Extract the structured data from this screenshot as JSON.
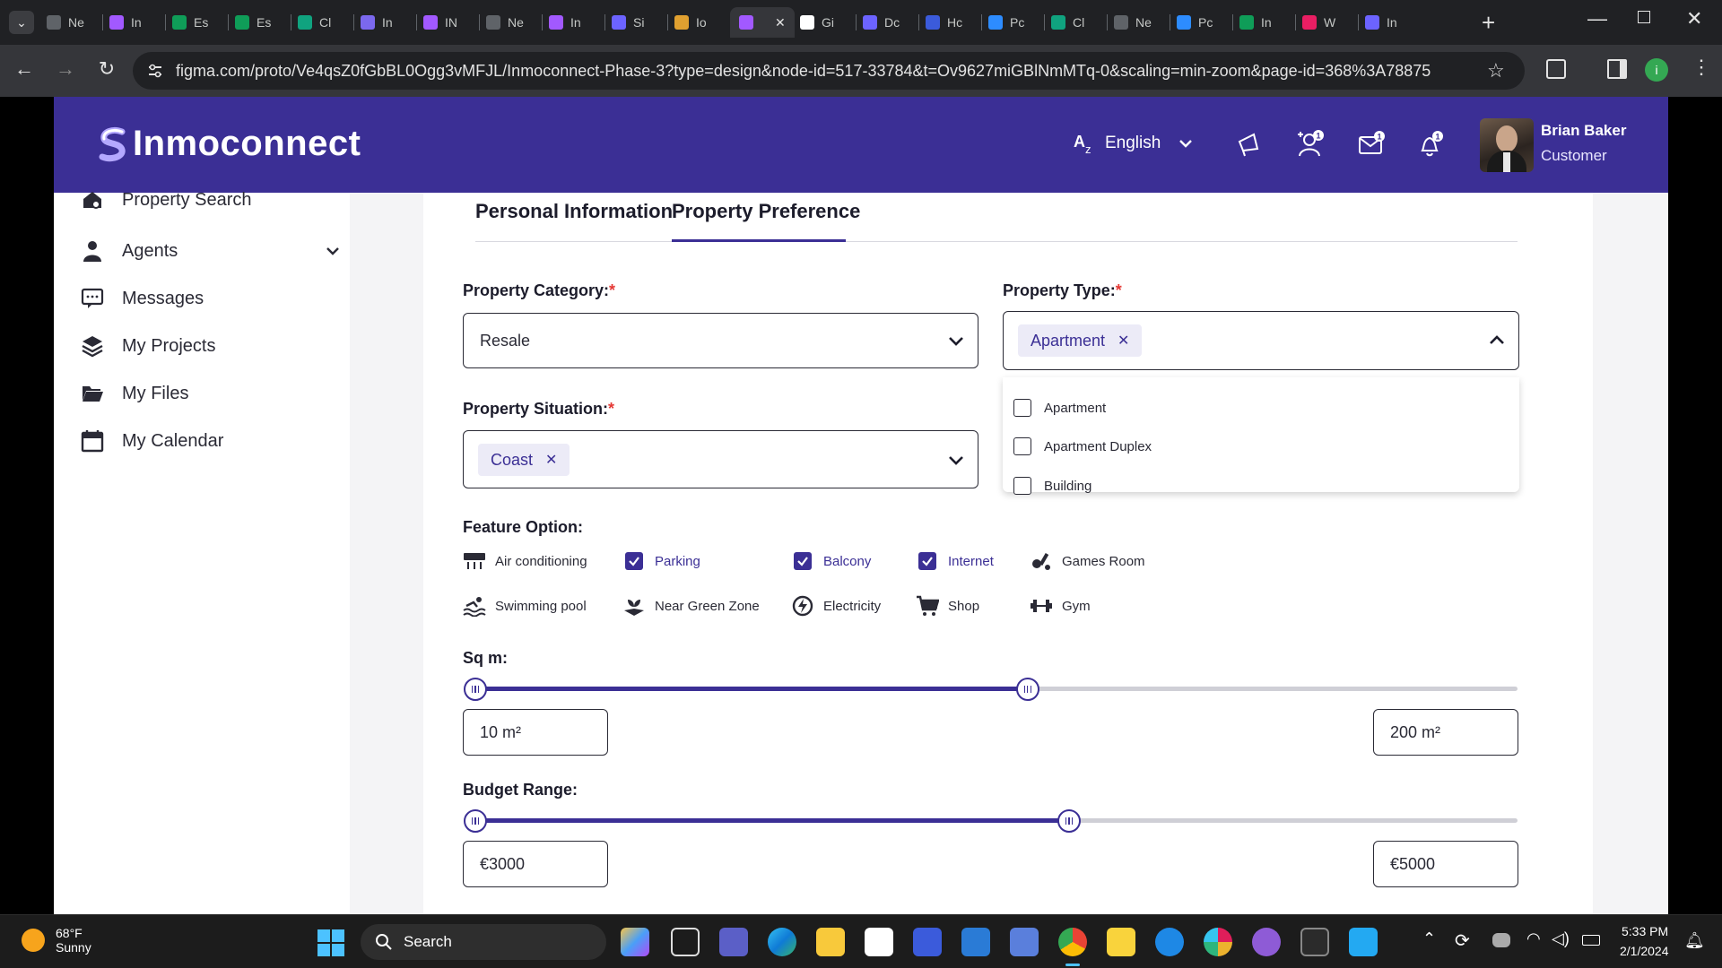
{
  "browser": {
    "tabs": [
      {
        "label": "Ne",
        "color": "#5f6368"
      },
      {
        "label": "In",
        "color": "#a259ff"
      },
      {
        "label": "Es",
        "color": "#0f9d58"
      },
      {
        "label": "Es",
        "color": "#0f9d58"
      },
      {
        "label": "Cl",
        "color": "#10a37f"
      },
      {
        "label": "In",
        "color": "#7b68ee"
      },
      {
        "label": "IN",
        "color": "#a259ff"
      },
      {
        "label": "Ne",
        "color": "#5f6368"
      },
      {
        "label": "In",
        "color": "#a259ff"
      },
      {
        "label": "Si",
        "color": "#6c63ff"
      },
      {
        "label": "Io",
        "color": "#e0a030"
      },
      {
        "label": "",
        "color": "#a259ff"
      },
      {
        "label": "Gi",
        "color": "#ffffff"
      },
      {
        "label": "Dc",
        "color": "#6c63ff"
      },
      {
        "label": "Hc",
        "color": "#3b5bdb"
      },
      {
        "label": "Pc",
        "color": "#2d8cff"
      },
      {
        "label": "Cl",
        "color": "#10a37f"
      },
      {
        "label": "Ne",
        "color": "#5f6368"
      },
      {
        "label": "Pc",
        "color": "#2d8cff"
      },
      {
        "label": "In",
        "color": "#0f9d58"
      },
      {
        "label": "W",
        "color": "#e91e63"
      },
      {
        "label": "In",
        "color": "#6c63ff"
      }
    ],
    "url": "figma.com/proto/Ve4qsZ0fGbBL0Ogg3vMFJL/Inmoconnect-Phase-3?type=design&node-id=517-33784&t=Ov9627miGBlNmMTq-0&scaling=min-zoom&page-id=368%3A78875"
  },
  "header": {
    "brand": "Inmoconnect",
    "language": "English",
    "user_name": "Brian Baker",
    "user_role": "Customer",
    "badge_count": "1"
  },
  "sidebar": {
    "items": [
      {
        "label": "Property Search",
        "icon": "house-search-icon"
      },
      {
        "label": "Agents",
        "icon": "agent-icon"
      },
      {
        "label": "Messages",
        "icon": "message-icon"
      },
      {
        "label": "My Projects",
        "icon": "layers-icon"
      },
      {
        "label": "My Files",
        "icon": "folder-icon"
      },
      {
        "label": "My Calendar",
        "icon": "calendar-icon"
      }
    ]
  },
  "main": {
    "tabs": [
      {
        "label": "Personal Information",
        "active": false
      },
      {
        "label": "Property Preference",
        "active": true
      }
    ],
    "category_label": "Property Category:",
    "category_value": "Resale",
    "type_label": "Property Type:",
    "type_chip": "Apartment",
    "type_options": [
      "Apartment",
      "Apartment Duplex",
      "Building"
    ],
    "situation_label": "Property Situation:",
    "situation_chip": "Coast",
    "feature_label": "Feature Option:",
    "features": [
      {
        "label": "Air conditioning",
        "checked": false,
        "icon": "air-conditioning-icon"
      },
      {
        "label": "Parking",
        "checked": true
      },
      {
        "label": "Balcony",
        "checked": true
      },
      {
        "label": "Internet",
        "checked": true
      },
      {
        "label": "Games Room",
        "checked": false,
        "icon": "games-room-icon"
      },
      {
        "label": "Swimming pool",
        "checked": false,
        "icon": "swimming-pool-icon"
      },
      {
        "label": "Near Green Zone",
        "checked": false,
        "icon": "green-zone-icon"
      },
      {
        "label": "Electricity",
        "checked": false,
        "icon": "electricity-icon"
      },
      {
        "label": "Shop",
        "checked": false,
        "icon": "shop-icon"
      },
      {
        "label": "Gym",
        "checked": false,
        "icon": "gym-icon"
      }
    ],
    "sqm_label": "Sq m:",
    "sqm_min": "10 m²",
    "sqm_max": "200 m²",
    "sqm_fill_fraction": 0.53,
    "budget_label": "Budget Range:",
    "budget_min": "€3000",
    "budget_max": "€5000",
    "budget_fill_fraction": 0.57
  },
  "colors": {
    "brand": "#3b2f95",
    "required": "#e53935"
  },
  "taskbar": {
    "temperature": "68°F",
    "weather": "Sunny",
    "search_placeholder": "Search",
    "time": "5:33 PM",
    "date": "2/1/2024"
  }
}
